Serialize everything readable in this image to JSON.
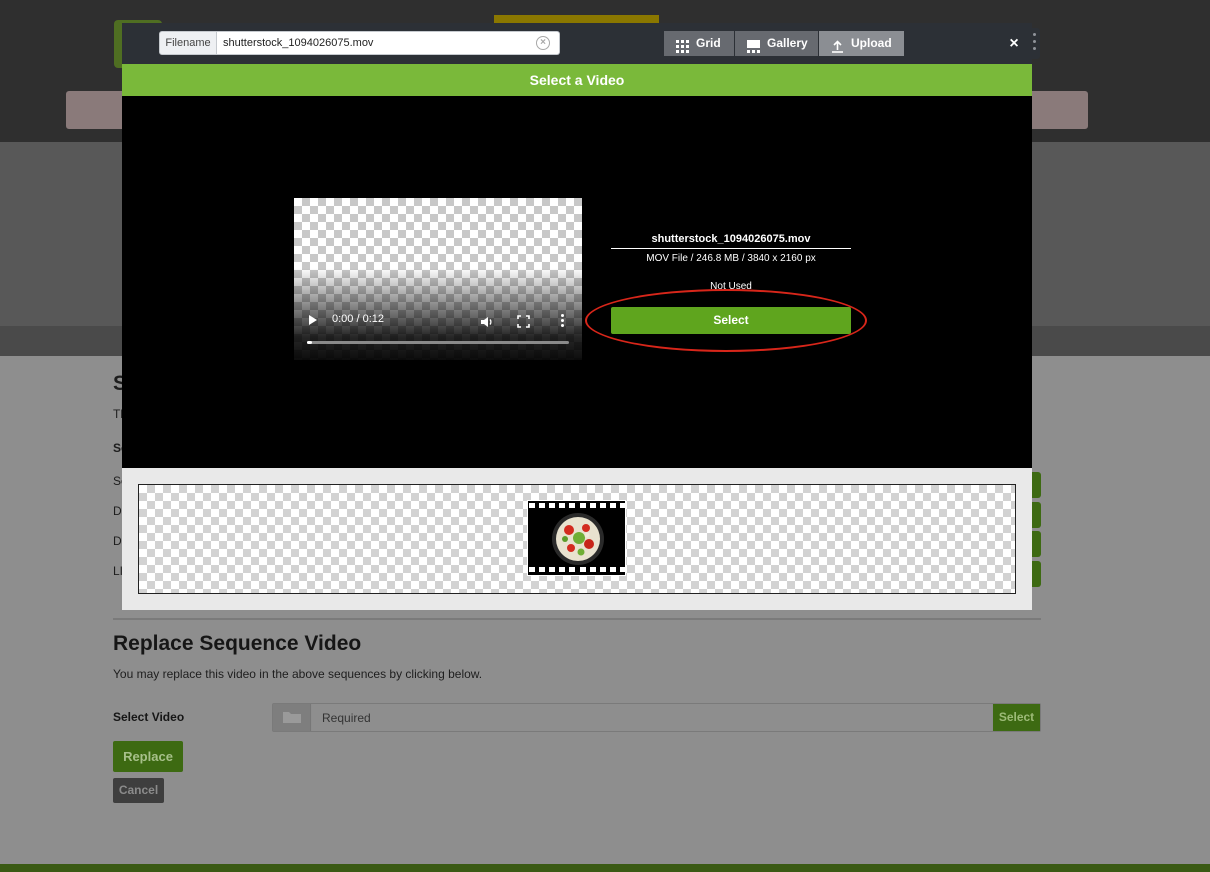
{
  "background_page": {
    "section_heading_initial": "S",
    "row_initials": [
      "Th",
      "Se",
      "Se",
      "De",
      "De",
      "LI"
    ],
    "replace_section": {
      "title": "Replace Sequence Video",
      "description": "You may replace this video in the above sequences by clicking below.",
      "select_video_label": "Select Video",
      "field_placeholder": "Required",
      "field_select_label": "Select",
      "replace_button": "Replace",
      "cancel_button": "Cancel"
    }
  },
  "modal": {
    "filename_label": "Filename",
    "filename_value": "shutterstock_1094026075.mov",
    "clear_icon": "×",
    "tabs": [
      {
        "label": "Grid",
        "icon": "grid-icon",
        "active": false
      },
      {
        "label": "Gallery",
        "icon": "gallery-icon",
        "active": false
      },
      {
        "label": "Upload",
        "icon": "upload-icon",
        "active": true
      }
    ],
    "close_label": "×",
    "title": "Select a Video",
    "player": {
      "time": "0:00 / 0:12",
      "progress": 0.02
    },
    "file": {
      "name": "shutterstock_1094026075.mov",
      "meta": "MOV File / 246.8 MB / 3840 x 2160 px",
      "status": "Not Used",
      "select_label": "Select"
    }
  },
  "colors": {
    "accent_green": "#7ab93a",
    "select_green": "#5fa51e",
    "highlight_red": "#d8261a",
    "header_dark": "#2c3036"
  }
}
